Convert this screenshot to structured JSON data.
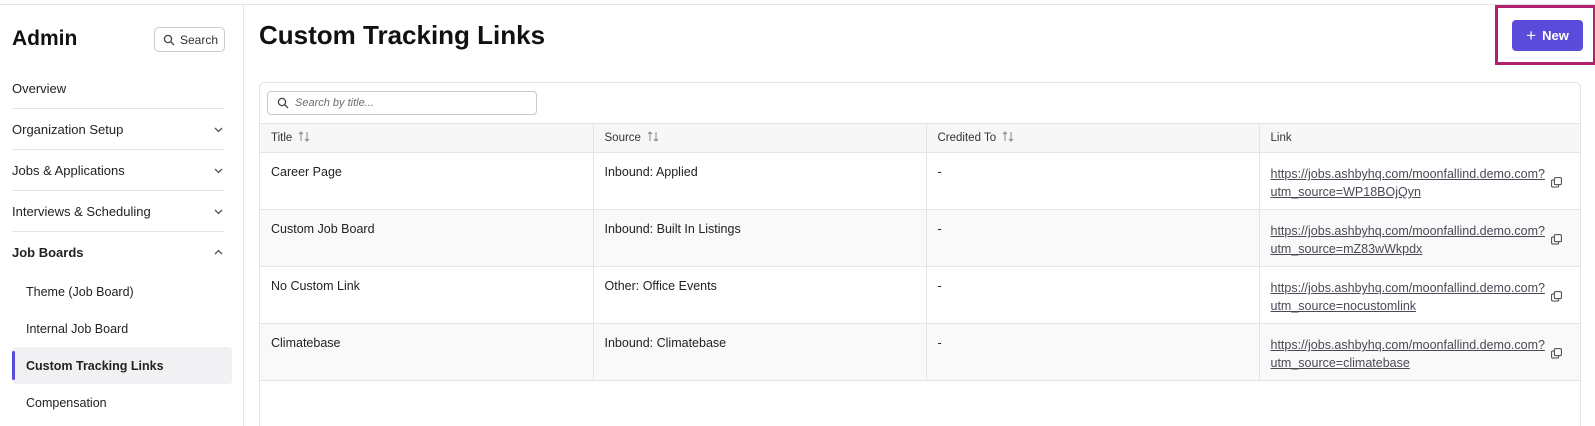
{
  "sidebar": {
    "title": "Admin",
    "search_label": "Search",
    "nav": [
      {
        "label": "Overview"
      },
      {
        "label": "Organization Setup"
      },
      {
        "label": "Jobs & Applications"
      },
      {
        "label": "Interviews & Scheduling"
      },
      {
        "label": "Job Boards"
      }
    ],
    "sub_items": [
      {
        "label": "Theme (Job Board)"
      },
      {
        "label": "Internal Job Board"
      },
      {
        "label": "Custom Tracking Links"
      },
      {
        "label": "Compensation"
      }
    ]
  },
  "main": {
    "title": "Custom Tracking Links",
    "new_button": "New",
    "search_placeholder": "Search by title...",
    "columns": [
      "Title",
      "Source",
      "Credited To",
      "Link"
    ],
    "rows": [
      {
        "title": "Career Page",
        "source": "Inbound: Applied",
        "credited": "-",
        "link1": "https://jobs.ashbyhq.com/moonfallind.demo.com?",
        "link2": "utm_source=WP18BOjQyn"
      },
      {
        "title": "Custom Job Board",
        "source": "Inbound: Built In Listings",
        "credited": "-",
        "link1": "https://jobs.ashbyhq.com/moonfallind.demo.com?",
        "link2": "utm_source=mZ83wWkpdx"
      },
      {
        "title": "No Custom Link",
        "source": "Other: Office Events",
        "credited": "-",
        "link1": "https://jobs.ashbyhq.com/moonfallind.demo.com?",
        "link2": "utm_source=nocustomlink"
      },
      {
        "title": "Climatebase",
        "source": "Inbound: Climatebase",
        "credited": "-",
        "link1": "https://jobs.ashbyhq.com/moonfallind.demo.com?",
        "link2": "utm_source=climatebase"
      }
    ]
  },
  "colors": {
    "accent": "#5b4bdb",
    "highlight": "#b0206e"
  },
  "icons": [
    "search-icon",
    "chevron-down-icon",
    "chevron-up-icon",
    "plus-icon",
    "sort-icon",
    "copy-icon"
  ]
}
